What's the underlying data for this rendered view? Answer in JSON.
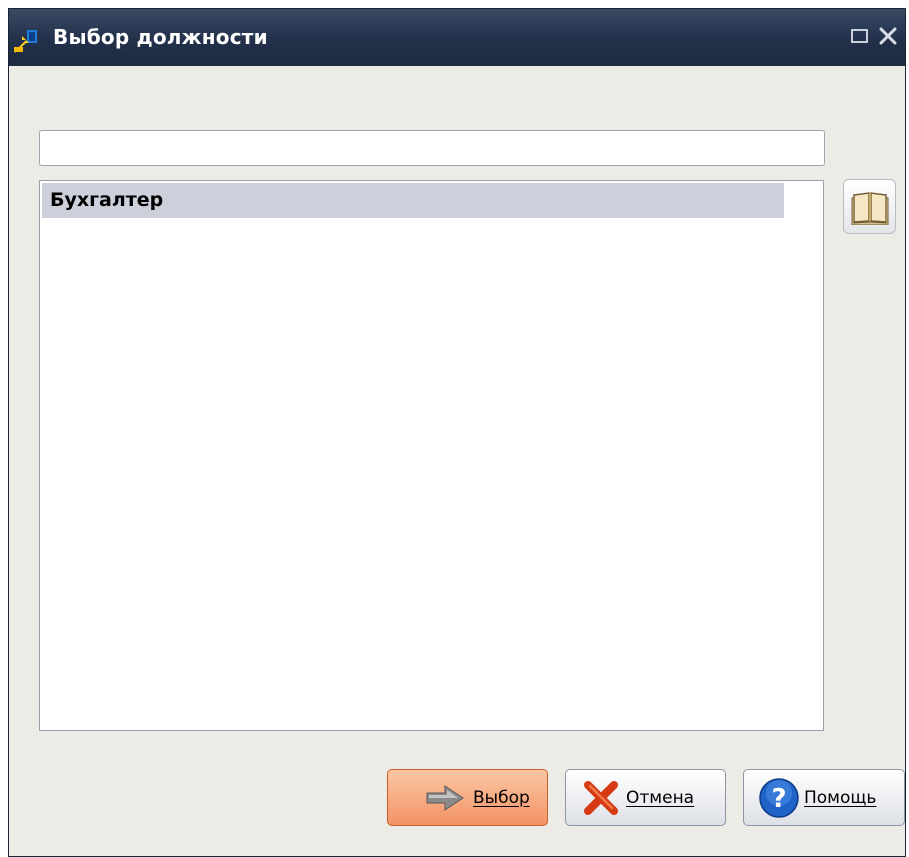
{
  "window": {
    "title": "Выбор должности",
    "icons": {
      "app": "app-icon",
      "maximize": "maximize-icon",
      "close": "close-icon"
    }
  },
  "search": {
    "value": "",
    "placeholder": ""
  },
  "list": {
    "items": [
      {
        "label": "Бухгалтер",
        "selected": true
      }
    ]
  },
  "side_button": {
    "icon": "book-icon"
  },
  "buttons": {
    "select": {
      "label": "Выбор",
      "icon": "arrow-right-icon"
    },
    "cancel": {
      "label": "Отмена",
      "icon": "red-x-icon"
    },
    "help": {
      "label": "Помощь",
      "icon": "help-icon"
    }
  },
  "colors": {
    "titlebar": "#22304a",
    "window_bg": "#ecebe6",
    "selection": "#cdcfdb",
    "primary_button": "#f39366"
  }
}
